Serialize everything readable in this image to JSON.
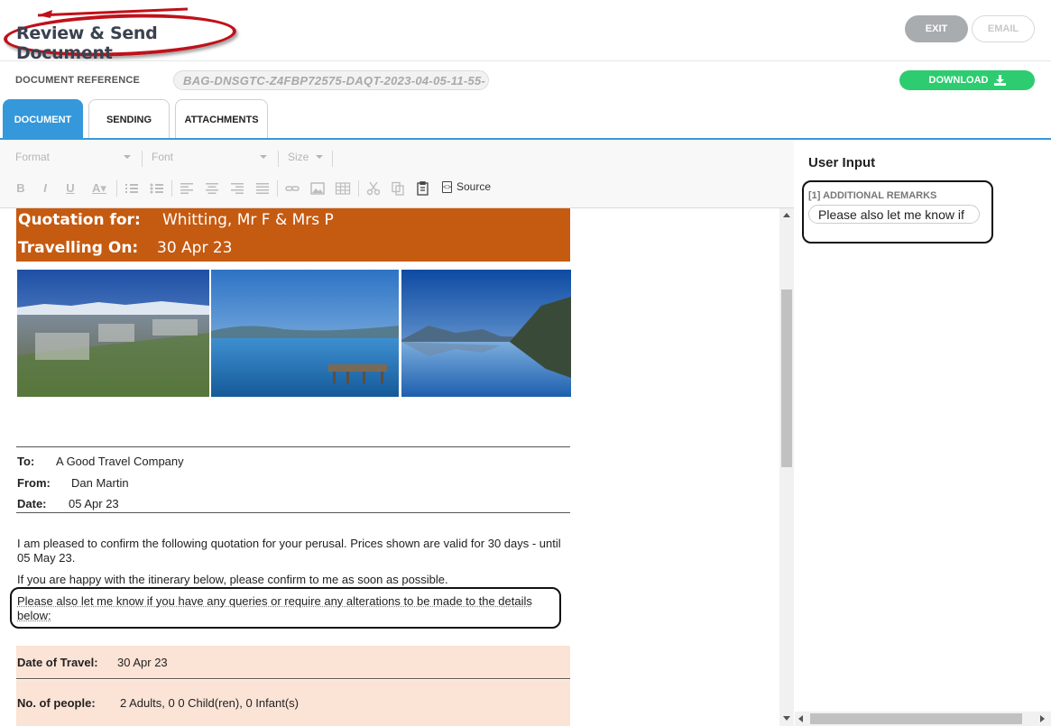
{
  "header": {
    "title": "Review & Send Document",
    "exit_label": "EXIT",
    "email_label": "EMAIL"
  },
  "reference": {
    "label": "DOCUMENT REFERENCE",
    "value": "BAG-DNSGTC-Z4FBP72575-DAQT-2023-04-05-11-55-",
    "download_label": "DOWNLOAD"
  },
  "tabs": [
    {
      "label": "DOCUMENT",
      "active": true
    },
    {
      "label": "SENDING",
      "active": false
    },
    {
      "label": "ATTACHMENTS",
      "active": false
    }
  ],
  "toolbar": {
    "format_placeholder": "Format",
    "font_placeholder": "Font",
    "size_placeholder": "Size",
    "source_label": "Source"
  },
  "document": {
    "quotation_label": "Quotation for:",
    "quotation_value": "Whitting, Mr F & Mrs P",
    "travelling_label": "Travelling On:",
    "travelling_value": "30 Apr 23",
    "to_label": "To:",
    "to_value": "A Good Travel Company",
    "from_label": "From:",
    "from_value": "Dan Martin",
    "date_label": "Date:",
    "date_value": "05 Apr 23",
    "para1": "I am pleased to confirm the following quotation for your perusal. Prices shown are valid for 30 days - until 05 May 23.",
    "para2": "If you are happy with the itinerary below, please confirm to me as soon as possible.",
    "para3": "Please also let me know if you have any queries or require any alterations to be made to the details below:",
    "travel_date_label": "Date of Travel:",
    "travel_date_value": "30 Apr 23",
    "people_label": "No. of people:",
    "people_value": "2 Adults, 0 0 Child(ren), 0 Infant(s)"
  },
  "user_input": {
    "title": "User Input",
    "field_label": "[1] ADDITIONAL REMARKS",
    "field_value": "Please also let me know if"
  },
  "colors": {
    "accent": "#3498db",
    "banner": "#c55a11",
    "peach": "#fbe3d6",
    "download": "#2ecc71",
    "annotation": "#c0111a"
  }
}
